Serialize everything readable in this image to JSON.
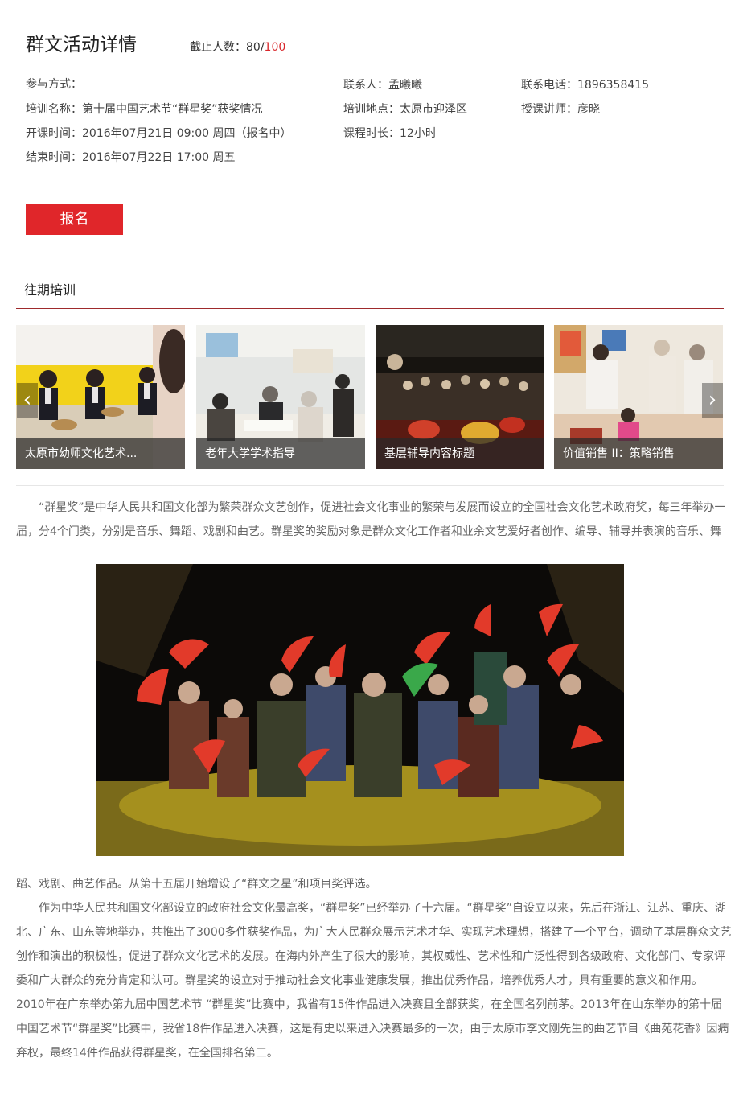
{
  "header": {
    "title": "群文活动详情",
    "quota_label": "截止人数：80/",
    "quota_max": "100"
  },
  "info": {
    "participation": "参与方式：",
    "training_name": "培训名称：第十届中国艺术节“群星奖”获奖情况",
    "start_time": "开课时间：2016年07月21日 09:00 周四（报名中）",
    "end_time": "结束时间：2016年07月22日 17:00 周五",
    "contact": "联系人：孟曦曦",
    "location": "培训地点：太原市迎泽区",
    "duration": "课程时长：12小时",
    "phone": "联系电话：1896358415",
    "lecturer": "授课讲师：彦晓"
  },
  "actions": {
    "signup_label": "报名"
  },
  "past": {
    "section_title": "往期培训",
    "items": [
      {
        "caption": "太原市幼师文化艺术...",
        "image": "children-class-photo"
      },
      {
        "caption": "老年大学学术指导",
        "image": "senior-classroom-photo"
      },
      {
        "caption": "基层辅导内容标题",
        "image": "night-crowd-photo"
      },
      {
        "caption": "价值销售 II：策略销售",
        "image": "art-room-photo"
      }
    ],
    "prev_icon": "chevron-left-icon",
    "next_icon": "chevron-right-icon"
  },
  "article": {
    "para1_line1": "“群星奖”是中华人民共和国文化部为繁荣群众文艺创作，促进社会文化事业的繁荣与发展而设立的全国社会文化艺术政府奖，每三年举办一",
    "para1_line2": "届，分4个门类，分别是音乐、舞蹈、戏剧和曲艺。群星奖的奖励对象是群众文化工作者和业余文艺爱好者创作、编导、辅导并表演的音乐、舞",
    "image": "fan-dance-stage-photo",
    "para1_line3": "蹈、戏剧、曲艺作品。从第十五届开始增设了“群文之星”和项目奖评选。",
    "para2": "作为中华人民共和国文化部设立的政府社会文化最高奖，“群星奖”已经举办了十六届。“群星奖”自设立以来，先后在浙江、江苏、重庆、湖北、广东、山东等地举办，共推出了3000多件获奖作品，为广大人民群众展示艺术才华、实现艺术理想，搭建了一个平台，调动了基层群众文艺创作和演出的积极性，促进了群众文化艺术的发展。在海内外产生了很大的影响，其权威性、艺术性和广泛性得到各级政府、文化部门、专家评委和广大群众的充分肯定和认可。群星奖的设立对于推动社会文化事业健康发展，推出优秀作品，培养优秀人才，具有重要的意义和作用。",
    "para3": "2010年在广东举办第九届中国艺术节 “群星奖”比赛中，我省有15件作品进入决赛且全部获奖，在全国名列前茅。2013年在山东举办的第十届中国艺术节“群星奖”比赛中，我省18件作品进入决赛，这是有史以来进入决赛最多的一次，由于太原市李文刚先生的曲艺节目《曲苑花香》因病弃权，最终14件作品获得群星奖，在全国排名第三。"
  },
  "colors": {
    "accent": "#e0262a",
    "rule": "#9e2a2c",
    "text": "#666666"
  }
}
